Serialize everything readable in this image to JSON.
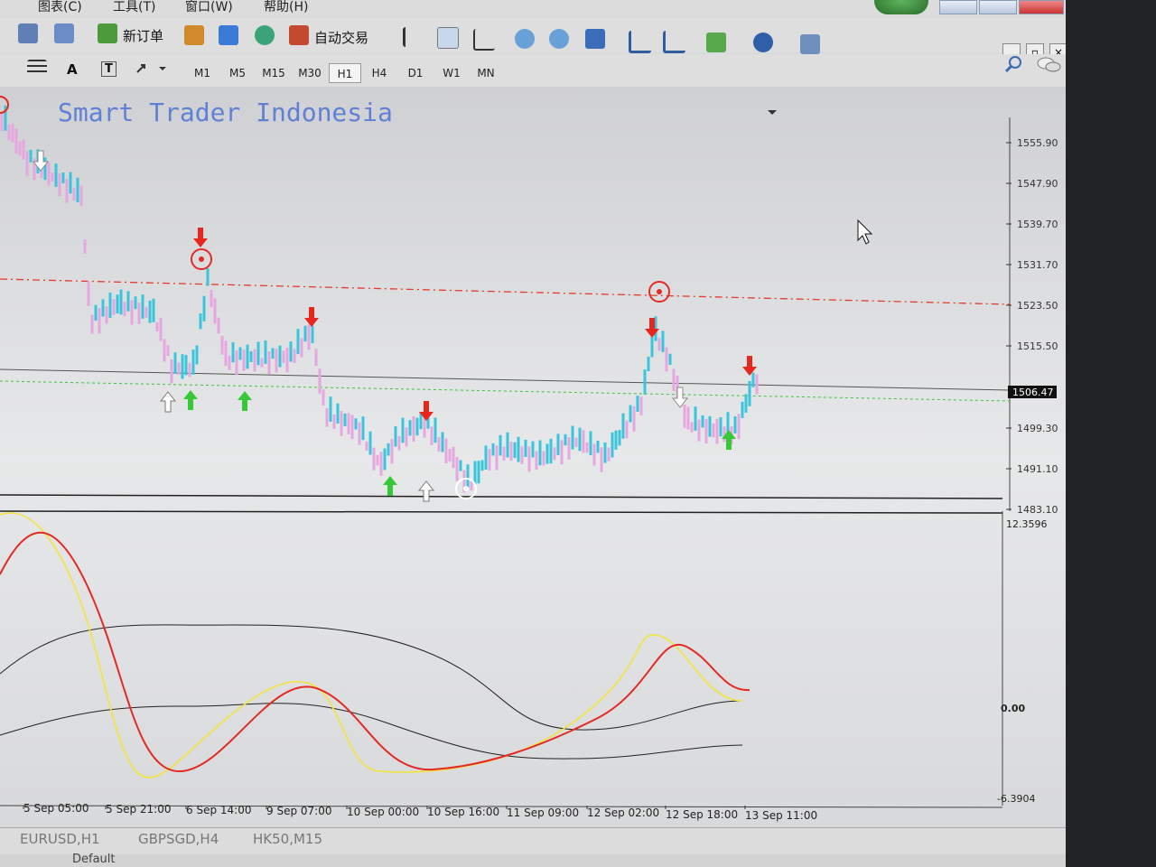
{
  "menu": {
    "item1": "图表(C)",
    "item2": "工具(T)",
    "item3": "窗口(W)",
    "item4": "帮助(H)"
  },
  "toolbar": {
    "new_order": "新订单",
    "auto_trading": "自动交易",
    "text_tool": "A",
    "text_label_tool": "T"
  },
  "timeframes": [
    "M1",
    "M5",
    "M15",
    "M30",
    "H1",
    "H4",
    "D1",
    "W1",
    "MN"
  ],
  "active_timeframe": "H1",
  "chart": {
    "watermark": "Smart Trader Indonesia",
    "price_ticks": [
      "1555.90",
      "1547.90",
      "1539.70",
      "1531.70",
      "1523.50",
      "1515.50",
      "1499.30",
      "1491.10",
      "1483.10"
    ],
    "current_price": "1506.47",
    "indicator_top": "12.3596",
    "indicator_zero": "0.00",
    "indicator_bottom": "-6.3904",
    "time_ticks": [
      "5 Sep 05:00",
      "5 Sep 21:00",
      "6 Sep 14:00",
      "9 Sep 07:00",
      "10 Sep 00:00",
      "10 Sep 16:00",
      "11 Sep 09:00",
      "12 Sep 02:00",
      "12 Sep 18:00",
      "13 Sep 11:00"
    ],
    "colors": {
      "bull": "#39c6dc",
      "bear": "#e6a7e0",
      "resistance": "#e53b2a",
      "support": "#3cc43c",
      "sell_arrow": "#e8261e",
      "buy_arrow": "#37c837",
      "fast_line": "#f4e43a",
      "slow_line": "#e32a24"
    }
  },
  "tabs": [
    "EURUSD,H1",
    "GBPSGD,H4",
    "HK50,M15"
  ],
  "status": {
    "profile": "Default"
  }
}
